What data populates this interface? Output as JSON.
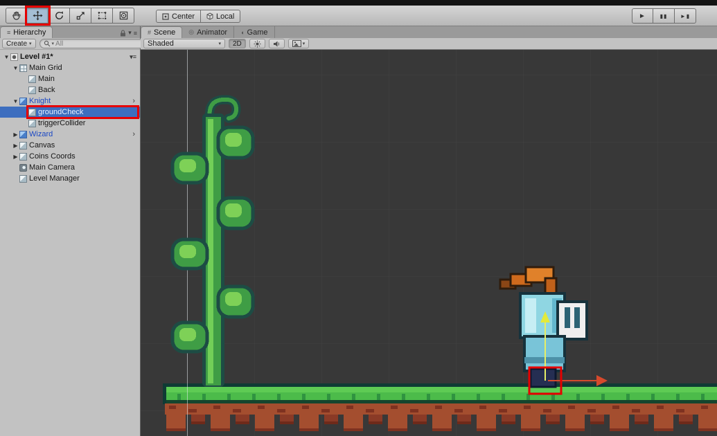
{
  "palette": {
    "annotation-red": "#e60000",
    "selection-blue": "#3d6ebf",
    "prefab-blue": "#1a47c4",
    "tabbar-bg": "#9a9a9a",
    "viewport-bg": "#383838",
    "grass-green": "#4cbb4a",
    "dirt-brown": "#a44e2f",
    "gizmo-x-red": "#d6492c",
    "gizmo-y-yellow": "#e3ea3a"
  },
  "toolbar": {
    "tools": [
      {
        "name": "hand-tool"
      },
      {
        "name": "move-tool",
        "selected": true,
        "annotated": true
      },
      {
        "name": "rotate-tool"
      },
      {
        "name": "scale-tool"
      },
      {
        "name": "rect-tool"
      },
      {
        "name": "transform-tool"
      }
    ],
    "pivot_label": "Center",
    "space_label": "Local"
  },
  "playback": {
    "play": "►",
    "pause": "▮▮",
    "step": "►▮"
  },
  "hierarchy": {
    "tab_label": "Hierarchy",
    "create_label": "Create",
    "search_placeholder": "All",
    "scene_root": {
      "label": "Level #1*"
    },
    "items": [
      {
        "label": "Main Grid",
        "depth": 1,
        "arrow": "open",
        "icon": "grid"
      },
      {
        "label": "Main",
        "depth": 2,
        "icon": "cube"
      },
      {
        "label": "Back",
        "depth": 2,
        "icon": "cube"
      },
      {
        "label": "Knight",
        "depth": 1,
        "arrow": "open",
        "icon": "cube-blue",
        "prefab": true,
        "chevron": true
      },
      {
        "label": "groundCheck",
        "depth": 2,
        "icon": "cube",
        "selected": true,
        "annotated": true,
        "prefab": true
      },
      {
        "label": "triggerCollider",
        "depth": 2,
        "icon": "cube"
      },
      {
        "label": "Wizard",
        "depth": 1,
        "arrow": "closed",
        "icon": "cube-blue",
        "prefab": true,
        "chevron": true
      },
      {
        "label": "Canvas",
        "depth": 1,
        "arrow": "closed",
        "icon": "cube"
      },
      {
        "label": "Coins Coords",
        "depth": 1,
        "arrow": "closed",
        "icon": "cube"
      },
      {
        "label": "Main Camera",
        "depth": 1,
        "icon": "camera"
      },
      {
        "label": "Level Manager",
        "depth": 1,
        "icon": "cube"
      }
    ]
  },
  "scene_panel": {
    "tabs": [
      {
        "label": "Scene",
        "icon_glyph": "#",
        "active": true
      },
      {
        "label": "Animator",
        "icon_glyph": "◎"
      },
      {
        "label": "Game",
        "icon_glyph": "◖"
      }
    ],
    "render_mode": "Shaded",
    "toggle_2d": "2D"
  },
  "icons": {
    "disclosure_open": "▼",
    "disclosure_closed": "▶",
    "dropdown": "▾",
    "menu": "≡",
    "prefab_chevron": "›",
    "hierarchy_tab": "≡"
  }
}
